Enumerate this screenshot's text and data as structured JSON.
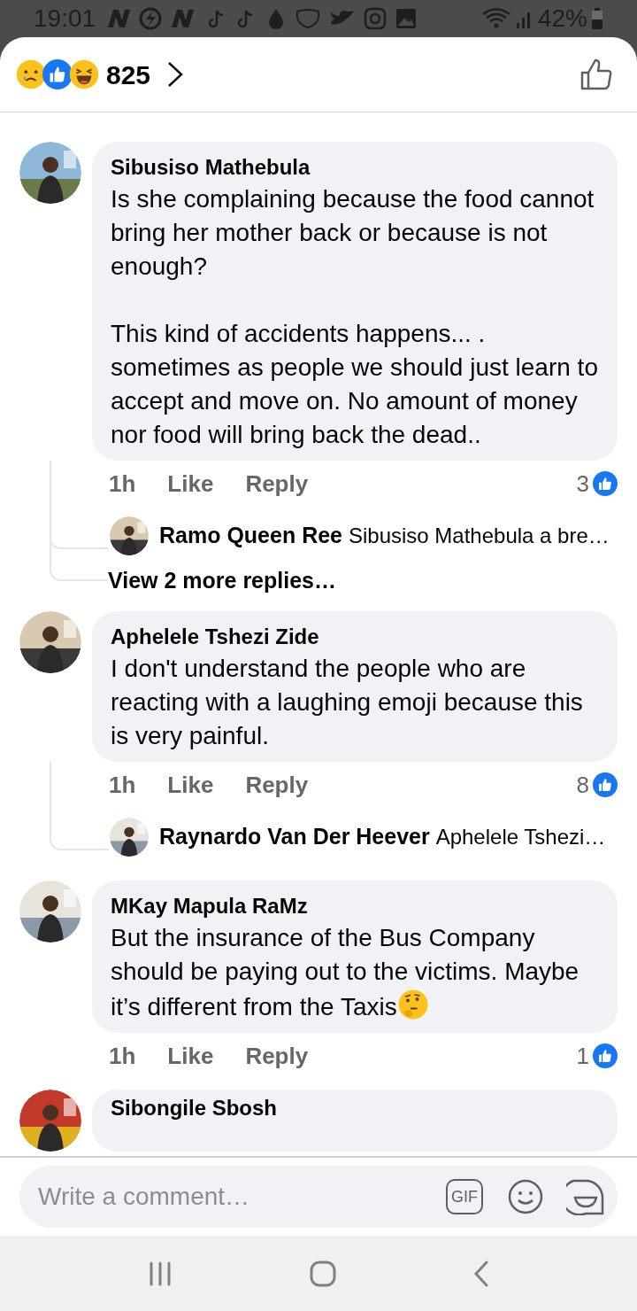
{
  "status_bar": {
    "time": "19:01",
    "battery": "42%"
  },
  "header": {
    "reaction_count": "825"
  },
  "comments": [
    {
      "author": "Sibusiso Mathebula",
      "paragraphs": [
        "Is she complaining because the food cannot bring her mother back or because is not enough?",
        "This kind of accidents happens... . sometimes as people we should just learn to accept and move on. No amount of money nor food will bring back the dead.."
      ],
      "time": "1h",
      "like_label": "Like",
      "reply_label": "Reply",
      "likes": "3",
      "replies": [
        {
          "author": "Ramo Queen Ree",
          "text": "Sibusiso Mathebula a bre…"
        }
      ],
      "more_replies": "View 2 more replies…"
    },
    {
      "author": "Aphelele Tshezi Zide",
      "paragraphs": [
        "I don't understand the people who are reacting with a laughing emoji because this is very painful."
      ],
      "time": "1h",
      "like_label": "Like",
      "reply_label": "Reply",
      "likes": "8",
      "replies": [
        {
          "author": "Raynardo Van Der Heever",
          "text": "Aphelele Tshezi…"
        }
      ]
    },
    {
      "author": "MKay Mapula RaMz",
      "paragraphs": [
        "But the insurance of the Bus Company should be paying out to the victims. Maybe it’s different from the Taxis"
      ],
      "ends_with_emoji": true,
      "time": "1h",
      "like_label": "Like",
      "reply_label": "Reply",
      "likes": "1"
    },
    {
      "author": "Sibongile Sbosh"
    }
  ],
  "composer": {
    "placeholder": "Write a comment…",
    "gif_label": "GIF"
  }
}
